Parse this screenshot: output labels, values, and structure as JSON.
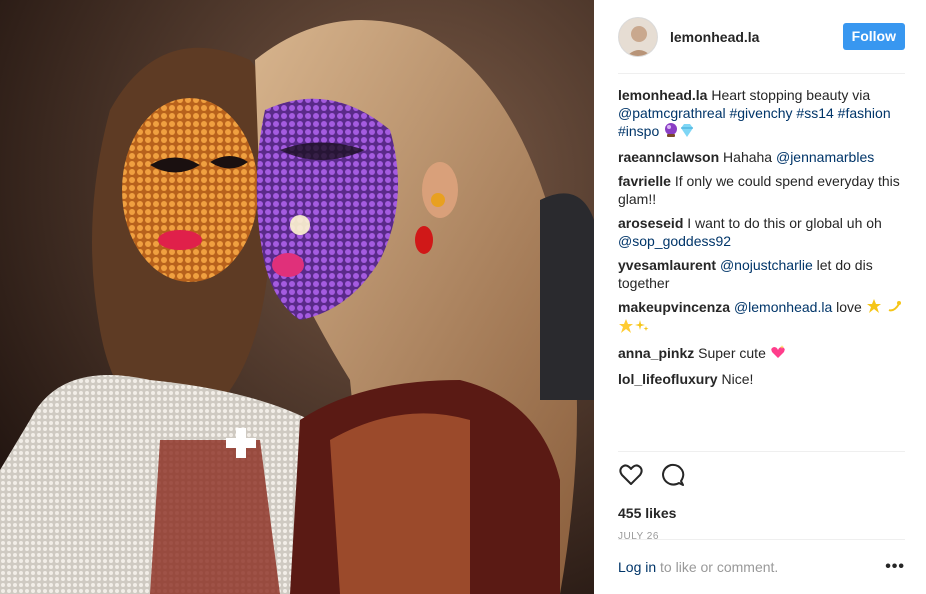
{
  "post": {
    "username": "lemonhead.la",
    "follow_label": "Follow",
    "caption": {
      "user": "lemonhead.la",
      "text1": " Heart stopping beauty via ",
      "mention": "@patmcgrathreal",
      "tags": [
        " #givenchy",
        " #ss14",
        " #fashion",
        " #inspo"
      ],
      "emoji": [
        "crystal-ball",
        "gem"
      ]
    },
    "comments": [
      {
        "user": "raeannclawson",
        "pre": " Hahaha ",
        "mention": "@jennamarbles",
        "post": ""
      },
      {
        "user": "favrielle",
        "pre": " If only we could spend everyday this glam!!",
        "mention": "",
        "post": ""
      },
      {
        "user": "aroseseid",
        "pre": " I want to do this or global uh oh ",
        "mention": "@sop_goddess92",
        "post": ""
      },
      {
        "user": "yvesamlaurent",
        "pre": " ",
        "mention": "@nojustcharlie",
        "post": " let do dis together"
      },
      {
        "user": "makeupvincenza",
        "pre": " ",
        "mention": "@lemonhead.la",
        "post": " love "
      },
      {
        "user": "anna_pinkz",
        "pre": " Super cute ",
        "mention": "",
        "post": ""
      },
      {
        "user": "lol_lifeofluxury",
        "pre": " Nice!",
        "mention": "",
        "post": ""
      }
    ],
    "likes": "455 likes",
    "date": "JULY 26",
    "login_link": "Log in",
    "login_rest": " to like or comment.",
    "more_label": "•••",
    "icons": {
      "like": "heart-icon",
      "comment": "comment-icon",
      "more": "more-options-icon"
    },
    "colors": {
      "accent": "#3897f0",
      "link": "#003569",
      "muted": "#999999"
    }
  }
}
